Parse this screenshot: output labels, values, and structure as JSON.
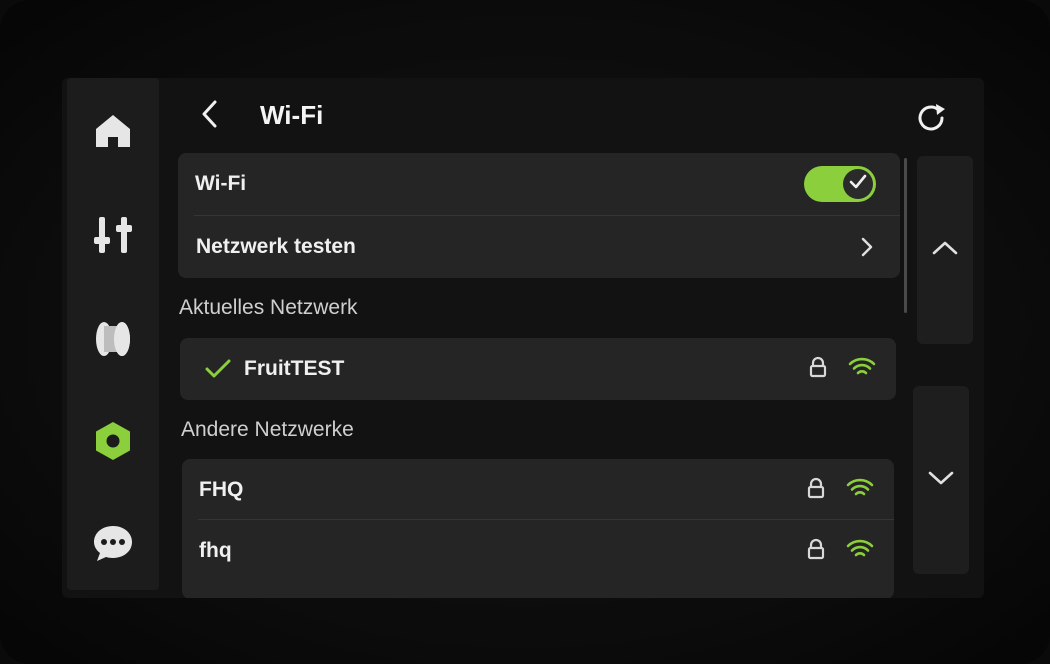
{
  "header": {
    "title": "Wi-Fi",
    "back_icon": "chevron-left-icon",
    "refresh_icon": "refresh-icon"
  },
  "sidebar": {
    "items": [
      {
        "name": "home",
        "icon": "home-icon"
      },
      {
        "name": "controls",
        "icon": "sliders-icon"
      },
      {
        "name": "material",
        "icon": "spool-icon"
      },
      {
        "name": "settings",
        "icon": "hexagon-settings-icon",
        "active": true
      },
      {
        "name": "messages",
        "icon": "chat-bubble-icon"
      }
    ]
  },
  "settings_card": {
    "wifi_label": "Wi-Fi",
    "wifi_enabled": true,
    "test_network_label": "Netzwerk testen"
  },
  "current_network": {
    "section_title": "Aktuelles Netzwerk",
    "ssid": "FruitTEST",
    "connected": true,
    "secured": true
  },
  "other_networks": {
    "section_title": "Andere Netzwerke",
    "items": [
      {
        "ssid": "FHQ",
        "secured": true
      },
      {
        "ssid": "fhq",
        "secured": true
      }
    ]
  },
  "paging": {
    "up_icon": "chevron-up-icon",
    "down_icon": "chevron-down-icon"
  },
  "colors": {
    "accent": "#8bcf3c",
    "background": "#121212",
    "card": "#252525",
    "sidebar": "#1c1c1c"
  }
}
